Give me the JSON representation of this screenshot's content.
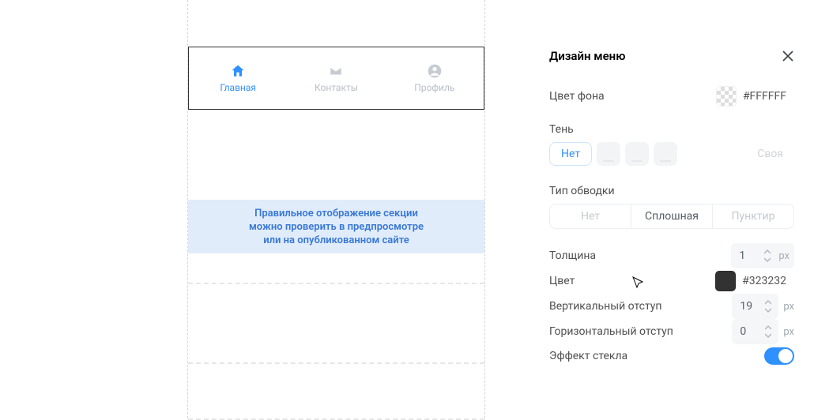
{
  "menu": {
    "items": [
      {
        "label": "Главная",
        "active": true
      },
      {
        "label": "Контакты",
        "active": false
      },
      {
        "label": "Профиль",
        "active": false
      }
    ]
  },
  "preview_notice": {
    "line1": "Правильное отображение секции",
    "line2": "можно проверить в предпросмотре",
    "line3": "или на опубликованном сайте"
  },
  "panel": {
    "title": "Дизайн меню",
    "bg_color_label": "Цвет фона",
    "bg_color_value": "#FFFFFF",
    "shadow_label": "Тень",
    "shadow_none": "Нет",
    "shadow_custom": "Своя",
    "stroke_type_label": "Тип обводки",
    "stroke_none": "Нет",
    "stroke_solid": "Сплошная",
    "stroke_dashed": "Пунктир",
    "thickness_label": "Толщина",
    "thickness_value": "1",
    "thickness_unit": "px",
    "color_label": "Цвет",
    "color_value": "#323232",
    "vpad_label": "Вертикальный отступ",
    "vpad_value": "19",
    "vpad_unit": "px",
    "hpad_label": "Горизонтальный отступ",
    "hpad_value": "0",
    "hpad_unit": "px",
    "glass_label": "Эффект стекла",
    "glass_on": true
  }
}
